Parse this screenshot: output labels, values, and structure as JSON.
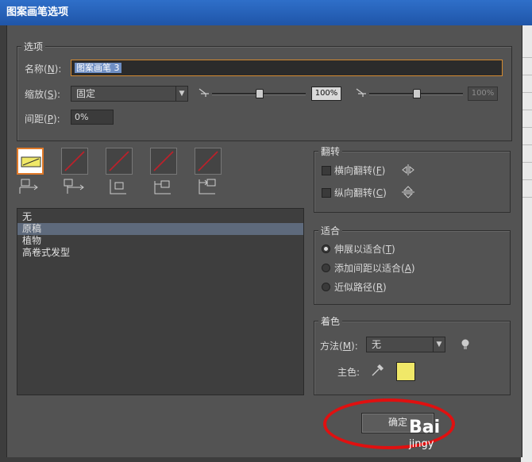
{
  "window": {
    "title": "图案画笔选项"
  },
  "options_group": {
    "legend": "选项",
    "name": {
      "label_pre": "名称(",
      "key": "N",
      "label_post": "):",
      "value": "图案画笔 3"
    },
    "scale": {
      "label_pre": "缩放(",
      "key": "S",
      "label_post": "):",
      "selected": "固定",
      "value1": "100%",
      "value2": "100%",
      "slider1_level": 0.5,
      "slider2_level": 0.5
    },
    "spacing": {
      "label_pre": "间距(",
      "key": "P",
      "label_post": "):",
      "value": "0%"
    }
  },
  "tiles": {
    "selected_index": 0,
    "count": 5
  },
  "pattern_list": [
    "无",
    "原稿",
    "植物",
    "高卷式发型"
  ],
  "pattern_list_selected": 1,
  "flip_group": {
    "legend": "翻转",
    "horizontal": {
      "label_pre": "横向翻转(",
      "key": "F",
      "label_post": ")",
      "checked": false
    },
    "vertical": {
      "label_pre": "纵向翻转(",
      "key": "C",
      "label_post": ")",
      "checked": false
    }
  },
  "fit_group": {
    "legend": "适合",
    "options": [
      {
        "label_pre": "伸展以适合(",
        "key": "T",
        "label_post": ")",
        "checked": true
      },
      {
        "label_pre": "添加间距以适合(",
        "key": "A",
        "label_post": ")",
        "checked": false
      },
      {
        "label_pre": "近似路径(",
        "key": "R",
        "label_post": ")",
        "checked": false
      }
    ]
  },
  "color_group": {
    "legend": "着色",
    "method_label_pre": "方法(",
    "method_key": "M",
    "method_label_post": "):",
    "method_value": "无",
    "key_color_label": "主色:",
    "key_color": "#f0e868"
  },
  "buttons": {
    "ok": "确定"
  },
  "watermark": {
    "brand": "Bai",
    "sub": "jingy"
  },
  "colors": {
    "title_bar": "#1f55a8",
    "dialog_bg": "#535353",
    "highlight_ring": "#e01010",
    "tile_accent": "#e07a2a",
    "tile_slash": "#c0202a"
  }
}
